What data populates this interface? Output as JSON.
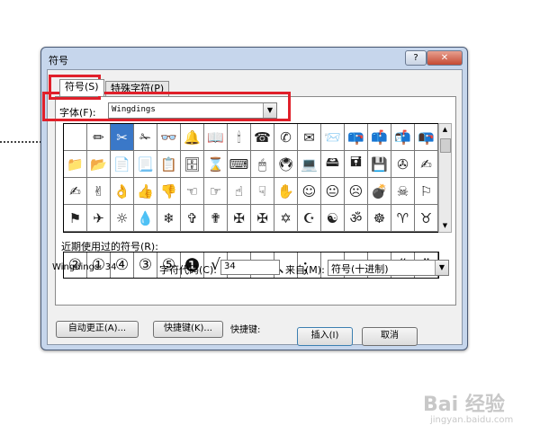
{
  "window": {
    "title": "符号",
    "help_label": "?",
    "close_label": "✕"
  },
  "tabs": [
    {
      "label": "符号(S)"
    },
    {
      "label": "特殊字符(P)"
    }
  ],
  "font": {
    "label": "字体(F):",
    "value": "Wingdings"
  },
  "symbols": [
    " ",
    "✏",
    "✂",
    "✁",
    "👓",
    "🔔",
    "📖",
    "🕯",
    "☎",
    "✆",
    "✉",
    "📨",
    "📪",
    "📫",
    "📬",
    "📭",
    "📁",
    "📂",
    "📄",
    "📃",
    "📋",
    "🗄",
    "⌛",
    "⌨",
    "🖱",
    "🖲",
    "💻",
    "🖴",
    "🖬",
    "💾",
    "✇",
    "✍",
    "✍",
    "✌",
    "👌",
    "👍",
    "👎",
    "☜",
    "☞",
    "☝",
    "☟",
    "✋",
    "☺",
    "😐",
    "☹",
    "💣",
    "☠",
    "⚐",
    "⚑",
    "✈",
    "☼",
    "💧",
    "❄",
    "✞",
    "✟",
    "✠",
    "✠",
    "✡",
    "☪",
    "☯",
    "ॐ",
    "☸",
    "♈",
    "♉"
  ],
  "selected_index": 2,
  "recent": {
    "label": "近期使用过的符号(R):",
    "symbols": [
      "②",
      "①",
      "④",
      "③",
      "⑤",
      "❶",
      "√",
      "，",
      "。",
      "、",
      "；",
      "：",
      "！",
      "？",
      "“",
      "”"
    ]
  },
  "info": {
    "code_text": "Wingdings: 34",
    "charcode_label": "字符代码(C):",
    "charcode_value": "34",
    "from_label": "来自(M):",
    "from_value": "符号(十进制)"
  },
  "buttons": {
    "autocorrect": "自动更正(A)...",
    "shortcut_key": "快捷键(K)...",
    "shortcut_text": "快捷键:",
    "insert": "插入(I)",
    "cancel": "取消"
  },
  "watermark": {
    "brand": "Bai 经验",
    "url": "jingyan.baidu.com"
  }
}
